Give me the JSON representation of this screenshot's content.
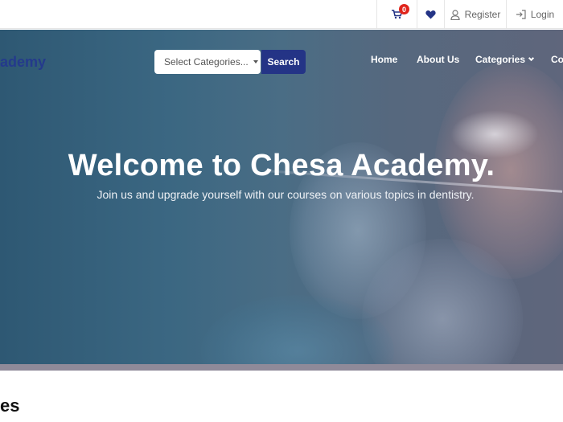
{
  "topbar": {
    "cart_count": "0",
    "register_label": "Register",
    "login_label": "Login"
  },
  "header": {
    "brand": "ademy",
    "category_placeholder": "Select Categories...",
    "search_label": "Search",
    "nav": {
      "home": "Home",
      "about": "About Us",
      "categories": "Categories",
      "more": "Co"
    }
  },
  "hero": {
    "title": "Welcome to Chesa Academy.",
    "subtitle": "Join us and upgrade yourself with our courses on various topics in dentistry."
  },
  "section": {
    "title": "es"
  },
  "colors": {
    "brand": "#243a8c",
    "button": "#243486",
    "badge": "#e0241b"
  },
  "icons": [
    "cart-icon",
    "heart-icon",
    "user-icon",
    "login-icon",
    "caret-down-icon",
    "chevron-down-icon"
  ]
}
